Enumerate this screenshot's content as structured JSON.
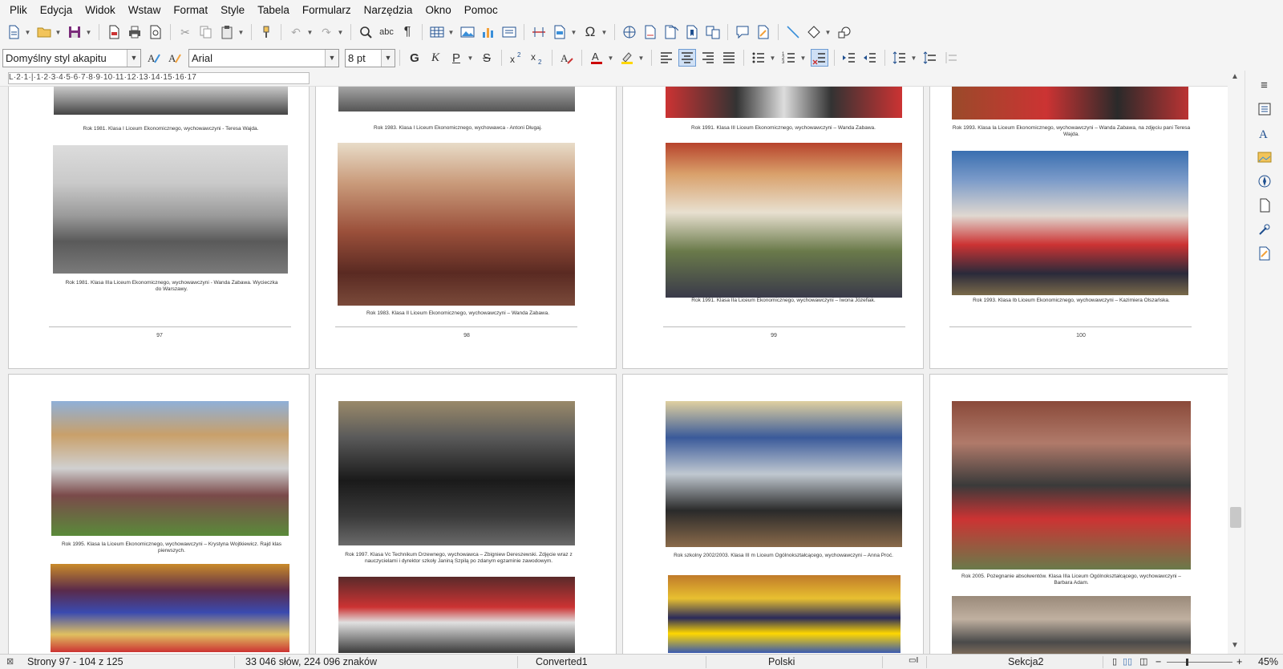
{
  "menu": [
    "Plik",
    "Edycja",
    "Widok",
    "Wstaw",
    "Format",
    "Style",
    "Tabela",
    "Formularz",
    "Narzędzia",
    "Okno",
    "Pomoc"
  ],
  "formatting": {
    "paragraph_style": "Domyślny styl akapitu",
    "font_name": "Arial",
    "font_size": "8 pt",
    "bold_label": "G",
    "italic_label": "K",
    "underline_label": "P",
    "strike_label": "S"
  },
  "ruler": {
    "marks": "L·2·1·|·1·2·3·4·5·6·7·8·9·10·11·12·13·14·15·16·17"
  },
  "pages": [
    {
      "number": "97",
      "captions": [
        "Rok 1981. Klasa I Liceum Ekonomicznego, wychowawczyni - Teresa Wajda.",
        "Rok 1981. Klasa IIIa Liceum Ekonomicznego, wychowawczyni - Wanda Zabawa. Wycieczka do Warszawy."
      ]
    },
    {
      "number": "98",
      "captions": [
        "Rok 1983. Klasa I Liceum Ekonomicznego, wychowawca - Antoni Długaj.",
        "Rok 1983. Klasa II Liceum Ekonomicznego, wychowawczyni – Wanda Zabawa."
      ]
    },
    {
      "number": "99",
      "captions": [
        "Rok 1991. Klasa III Liceum Ekonomicznego, wychowawczyni – Wanda Zabawa.",
        "Rok 1991. Klasa IIa Liceum Ekonomicznego, wychowawczyni – Iwona Józefiak."
      ]
    },
    {
      "number": "100",
      "captions": [
        "Rok 1993. Klasa Ia Liceum Ekonomicznego, wychowawczyni – Wanda Zabawa, na zdjęciu pani Teresa Wajda.",
        "Rok 1993. Klasa Ib Liceum Ekonomicznego, wychowawczyni – Kazimiera Olszańska."
      ]
    },
    {
      "captions": [
        "Rok 1995. Klasa Ia Liceum Ekonomicznego, wychowawczyni – Krystyna Wojtkiewicz. Rajd klas pierwszych."
      ]
    },
    {
      "captions": [
        "Rok 1997. Klasa Vc Technikum Drzewnego, wychowawca – Zbigniew Dereszewski. Zdjęcie wraz z nauczycielami i dyrektor szkoły Janiną Szpilą po zdanym egzaminie zawodowym."
      ]
    },
    {
      "captions": [
        "Rok szkolny 2002/2003. Klasa III m Liceum Ogólnokształcącego, wychowawczyni – Anna Proć."
      ]
    },
    {
      "captions": [
        "Rok 2005. Pożegnanie absolwentów. Klasa IIIa Liceum Ogólnokształcącego, wychowawczyni – Barbara Adam."
      ]
    }
  ],
  "status": {
    "pages": "Strony 97 - 104 z 125",
    "words": "33 046 słów, 224 096 znaków",
    "page_style": "Converted1",
    "language": "Polski",
    "section": "Sekcja2",
    "zoom": "45%"
  },
  "colors": {
    "accent": "#1f4f8f",
    "workspace": "#f0f0f0",
    "toolbar": "#f4f4f4"
  }
}
